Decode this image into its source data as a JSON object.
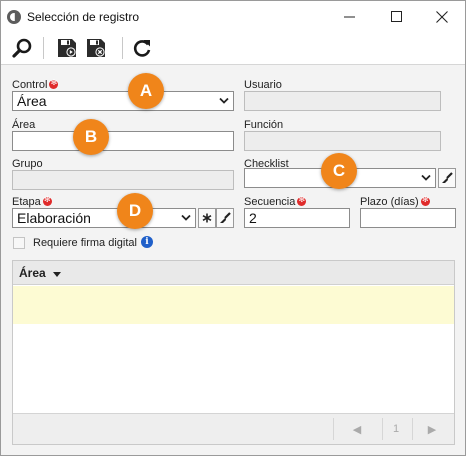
{
  "window": {
    "title": "Selección de registro",
    "controls": [
      "minimize-icon",
      "maximize-icon",
      "close-icon"
    ]
  },
  "toolbar": {
    "icons": [
      "search-icon",
      "save-icon",
      "save-close-icon",
      "refresh-icon"
    ]
  },
  "form": {
    "control": {
      "label": "Control",
      "value": "Área",
      "required": true
    },
    "usuario": {
      "label": "Usuario",
      "value": ""
    },
    "area": {
      "label": "Área",
      "value": ""
    },
    "funcion": {
      "label": "Función",
      "value": ""
    },
    "grupo": {
      "label": "Grupo",
      "value": ""
    },
    "checklist": {
      "label": "Checklist",
      "value": ""
    },
    "etapa": {
      "label": "Etapa",
      "value": "Elaboración",
      "required": true
    },
    "secuencia": {
      "label": "Secuencia",
      "value": "2",
      "required": true
    },
    "plazo": {
      "label": "Plazo (días)",
      "value": "",
      "required": true
    },
    "firma": {
      "label": "Requiere firma digital",
      "checked": false
    }
  },
  "badges": {
    "a": "A",
    "b": "B",
    "c": "C",
    "d": "D"
  },
  "grid": {
    "column_header": "Área",
    "pager": {
      "page": "1"
    }
  },
  "colors": {
    "badge": "#f0851a",
    "required": "#e02b2b",
    "row_highlight": "#fdfbd3",
    "info": "#1f5fc9"
  }
}
